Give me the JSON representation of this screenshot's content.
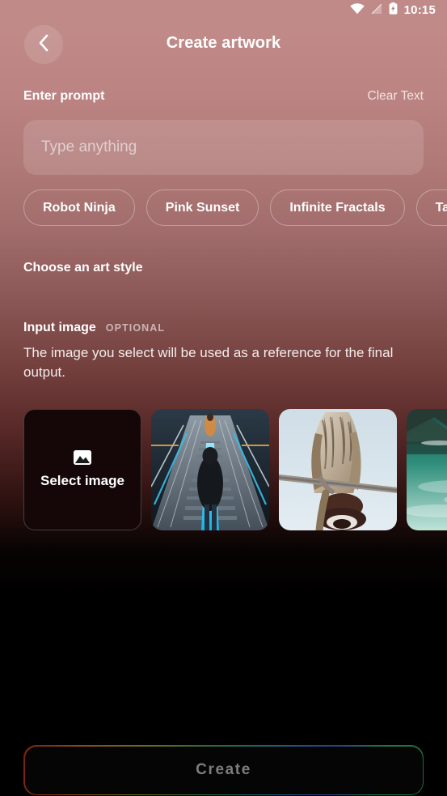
{
  "status_bar": {
    "time": "10:15",
    "icons": [
      "wifi-icon",
      "mobile-signal-off-icon",
      "battery-charging-icon"
    ]
  },
  "app_bar": {
    "back_icon": "chevron-left-icon",
    "title": "Create artwork"
  },
  "prompt_section": {
    "label": "Enter prompt",
    "clear_label": "Clear Text",
    "input_value": "",
    "input_placeholder": "Type anything",
    "chips": [
      {
        "label": "Robot Ninja"
      },
      {
        "label": "Pink Sunset"
      },
      {
        "label": "Infinite Fractals"
      },
      {
        "label": "Tall Bird"
      }
    ]
  },
  "art_style_section": {
    "label": "Choose an art style"
  },
  "input_image_section": {
    "label": "Input image",
    "badge": "OPTIONAL",
    "description": "The image you select will be used as a reference for the final output.",
    "select_card": {
      "icon": "image-placeholder-icon",
      "label": "Select image"
    },
    "thumbnails": [
      {
        "name": "escalator-neon-photo",
        "alt": "Person standing on escalator with blue neon lighting"
      },
      {
        "name": "owl-power-line-photo",
        "alt": "Owl perched on a power line insulator"
      },
      {
        "name": "lake-boat-photo",
        "alt": "Wooden boat on a turquoise mountain lake"
      }
    ]
  },
  "create_button": {
    "label": "Create",
    "enabled": false
  },
  "colors": {
    "background_top": "#c08a88",
    "background_bottom": "#000000",
    "text_primary": "#ffffff",
    "chip_border": "rgba(255,255,255,0.33)",
    "create_text": "#7d7d7d"
  }
}
